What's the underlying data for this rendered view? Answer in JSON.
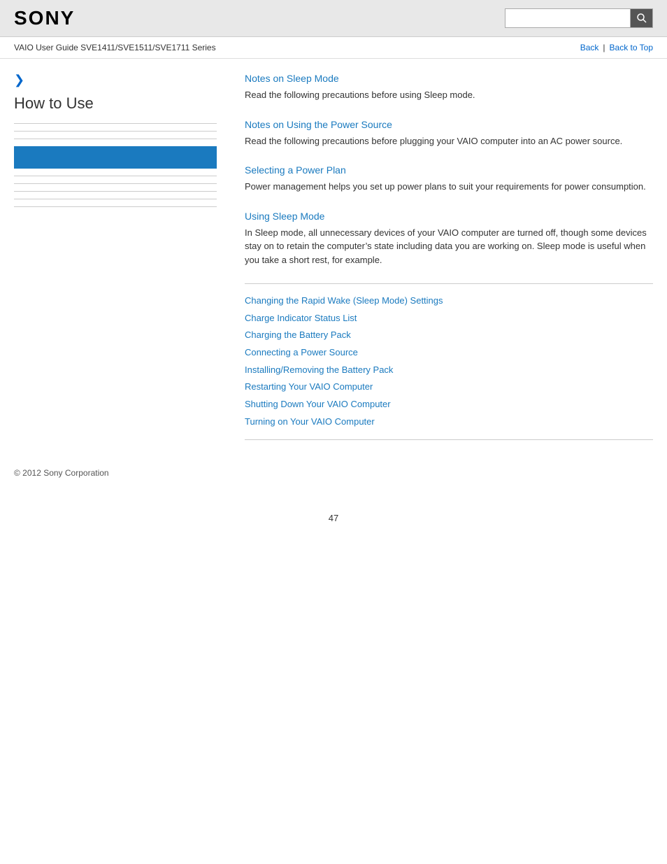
{
  "header": {
    "logo": "SONY",
    "search_placeholder": ""
  },
  "navbar": {
    "title": "VAIO User Guide SVE1411/SVE1511/SVE1711 Series",
    "back_label": "Back",
    "back_top_label": "Back to Top"
  },
  "sidebar": {
    "arrow": "❯",
    "title": "How to Use",
    "items": []
  },
  "content": {
    "sections": [
      {
        "id": "notes-sleep-mode",
        "title": "Notes on Sleep Mode",
        "text": "Read the following precautions before using Sleep mode."
      },
      {
        "id": "notes-power-source",
        "title": "Notes on Using the Power Source",
        "text": "Read the following precautions before plugging your VAIO computer into an AC power source."
      },
      {
        "id": "selecting-power-plan",
        "title": "Selecting a Power Plan",
        "text": "Power management helps you set up power plans to suit your requirements for power consumption."
      },
      {
        "id": "using-sleep-mode",
        "title": "Using Sleep Mode",
        "text": "In Sleep mode, all unnecessary devices of your VAIO computer are turned off, though some devices stay on to retain the computer’s state including data you are working on. Sleep mode is useful when you take a short rest, for example."
      }
    ],
    "links": [
      "Changing the Rapid Wake (Sleep Mode) Settings",
      "Charge Indicator Status List",
      "Charging the Battery Pack",
      "Connecting a Power Source",
      "Installing/Removing the Battery Pack",
      "Restarting Your VAIO Computer",
      "Shutting Down Your VAIO Computer",
      "Turning on Your VAIO Computer"
    ]
  },
  "footer": {
    "copyright": "© 2012 Sony Corporation"
  },
  "page_number": "47"
}
